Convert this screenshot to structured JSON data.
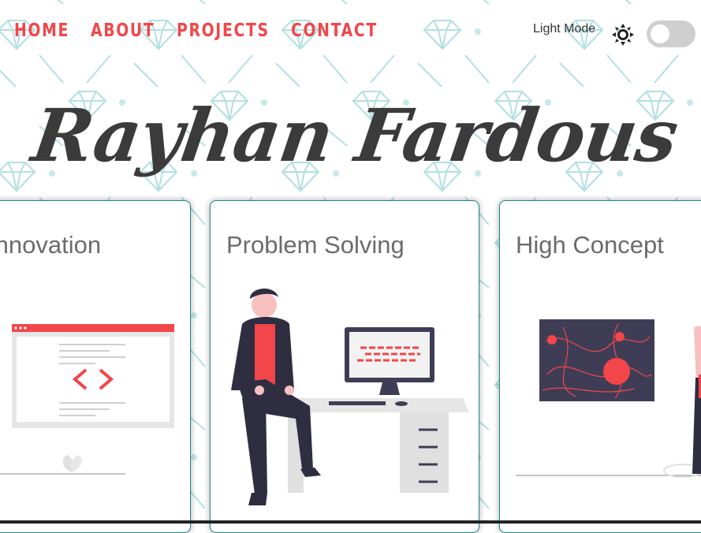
{
  "nav": {
    "items": [
      {
        "label": "HOME"
      },
      {
        "label": "ABOUT"
      },
      {
        "label": "PROJECTS"
      },
      {
        "label": "CONTACT"
      }
    ]
  },
  "theme": {
    "mode_label": "Light Mode",
    "icon": "sun-icon",
    "toggle_on": false
  },
  "hero": {
    "title": "Rayhan Fardous"
  },
  "cards": [
    {
      "title": "Innovation",
      "illustration": "code-window-illustration"
    },
    {
      "title": "Problem Solving",
      "illustration": "developer-desk-illustration"
    },
    {
      "title": "High Concept",
      "illustration": "concept-board-illustration"
    }
  ],
  "colors": {
    "accent": "#f2464a",
    "text_dark": "#3b3b3b",
    "card_border": "#1d8a84",
    "pattern": "#a9dde0"
  }
}
